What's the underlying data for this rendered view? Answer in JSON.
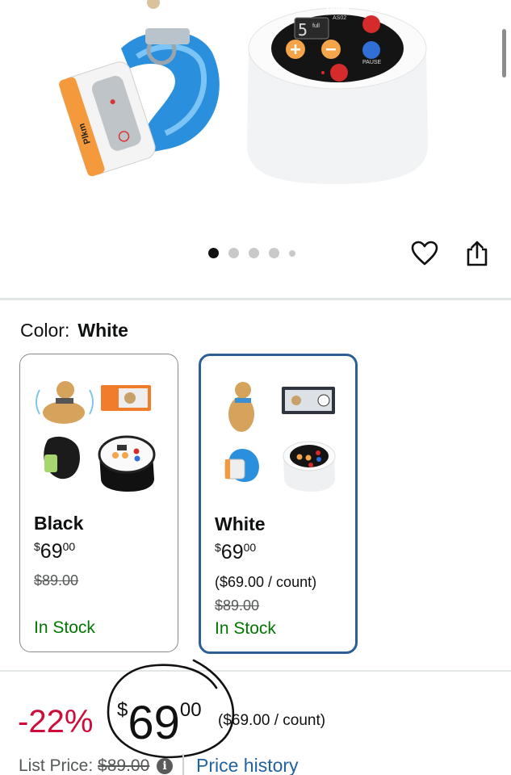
{
  "gallery": {
    "current_index": 1,
    "total": 5,
    "device_brand": "Plkm",
    "device_model": "AS02",
    "device_display": "5",
    "device_display_sub": "full",
    "device_pause_label": "PAUSE",
    "collar_brand": "Plkm"
  },
  "actions": {
    "favorite_icon": "heart-icon",
    "share_icon": "share-icon"
  },
  "color": {
    "label": "Color:",
    "selected": "White"
  },
  "options": [
    {
      "name": "Black",
      "price_dollars": "69",
      "price_cents": "00",
      "price_symbol": "$",
      "unit_price": "",
      "list_price": "$89.00",
      "stock": "In Stock"
    },
    {
      "name": "White",
      "price_dollars": "69",
      "price_cents": "00",
      "price_symbol": "$",
      "unit_price": "($69.00 / count)",
      "list_price": "$89.00",
      "stock": "In Stock"
    }
  ],
  "price_block": {
    "discount": "-22%",
    "symbol": "$",
    "dollars": "69",
    "cents": "00",
    "unit_price": "($69.00 / count)",
    "list_price_label": "List Price:",
    "list_price_value": "$89.00",
    "price_history_link": "Price history"
  },
  "colors": {
    "selected_border": "#2d5f93",
    "stock_green": "#007600",
    "discount_red": "#cc0c39",
    "link_blue": "#2162a1"
  }
}
